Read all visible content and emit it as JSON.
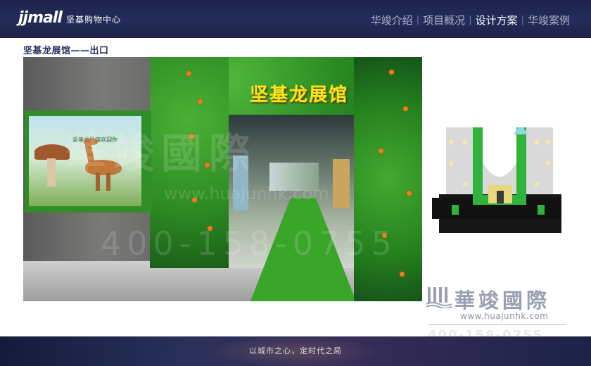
{
  "header": {
    "logo_mark": "jjmall",
    "logo_text": "坚基购物中心",
    "nav": [
      {
        "label": "华竣介绍",
        "active": false
      },
      {
        "label": "项目概况",
        "active": false
      },
      {
        "label": "设计方案",
        "active": true
      },
      {
        "label": "华竣案例",
        "active": false
      }
    ],
    "separator": "|"
  },
  "section": {
    "title": "坚基龙展馆——出口"
  },
  "render": {
    "arch_title": "坚基龙展馆",
    "billboard_title": "坚基龙展馆欢迎你",
    "watermark_big": "華竣國際",
    "watermark_url": "www.huajunhk.com",
    "watermark_phone": "400-158-0755"
  },
  "brand": {
    "name": "華竣國際",
    "url": "www.huajunhk.com",
    "phone": "400-158-0755"
  },
  "footer": {
    "slogan": "以城市之心，定时代之局"
  },
  "colors": {
    "header_bg": "#1d2349",
    "nav_active": "#ffffff",
    "nav_inactive": "#aeb3c9",
    "title_color": "#2a2f5c",
    "arch_title": "#f6e61d",
    "greenery": "#2c8a23"
  }
}
